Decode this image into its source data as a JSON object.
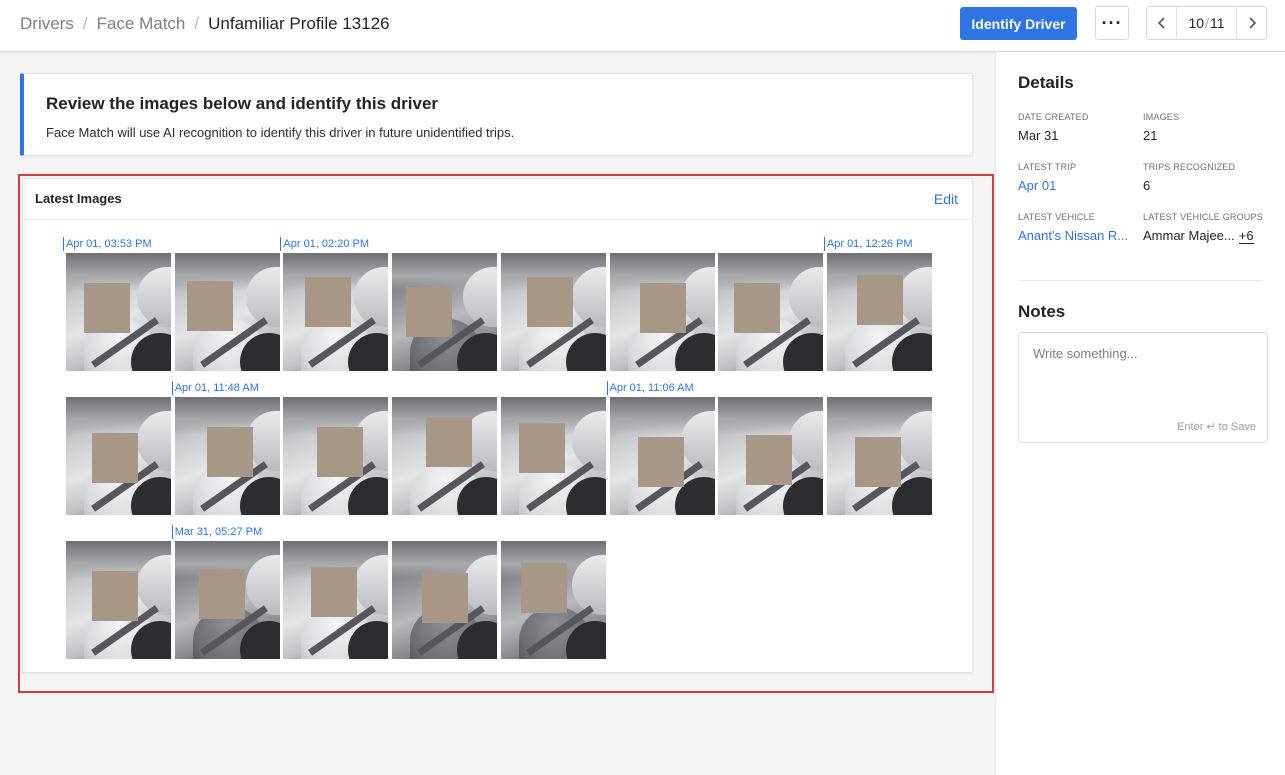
{
  "breadcrumb": {
    "items": [
      "Drivers",
      "Face Match"
    ],
    "current": "Unfamiliar Profile 13126",
    "separator": "/"
  },
  "toolbar": {
    "identify_label": "Identify Driver",
    "more_label": "···",
    "pager_current": "10",
    "pager_separator": "/",
    "pager_total": "11",
    "prev_icon": "chevron-left-icon",
    "next_icon": "chevron-right-icon"
  },
  "info": {
    "title": "Review the images below and identify this driver",
    "subtitle": "Face Match will use AI recognition to identify this driver in future unidentified trips."
  },
  "images": {
    "title": "Latest Images",
    "edit_label": "Edit",
    "date_labels": [
      "Apr 01, 03:53 PM",
      "Apr 01, 02:20 PM",
      "Apr 01, 12:26 PM",
      "Apr 01, 11:48 AM",
      "Apr 01, 11:06 AM",
      "Mar 31, 05:27 PM"
    ],
    "count": 21
  },
  "details": {
    "heading": "Details",
    "date_created_label": "DATE CREATED",
    "date_created": "Mar 31",
    "images_label": "IMAGES",
    "images": "21",
    "latest_trip_label": "LATEST TRIP",
    "latest_trip": "Apr 01",
    "trips_recognized_label": "TRIPS RECOGNIZED",
    "trips_recognized": "6",
    "latest_vehicle_label": "LATEST VEHICLE",
    "latest_vehicle": "Anant's Nissan R...",
    "latest_vehicle_groups_label": "LATEST VEHICLE GROUPS",
    "latest_vehicle_groups": "Ammar Majee...",
    "latest_vehicle_groups_more": "+6"
  },
  "notes": {
    "heading": "Notes",
    "placeholder": "Write something...",
    "hint": "Enter ↵ to Save"
  },
  "colors": {
    "accent": "#2f74e3",
    "highlight": "#d63b3b"
  }
}
